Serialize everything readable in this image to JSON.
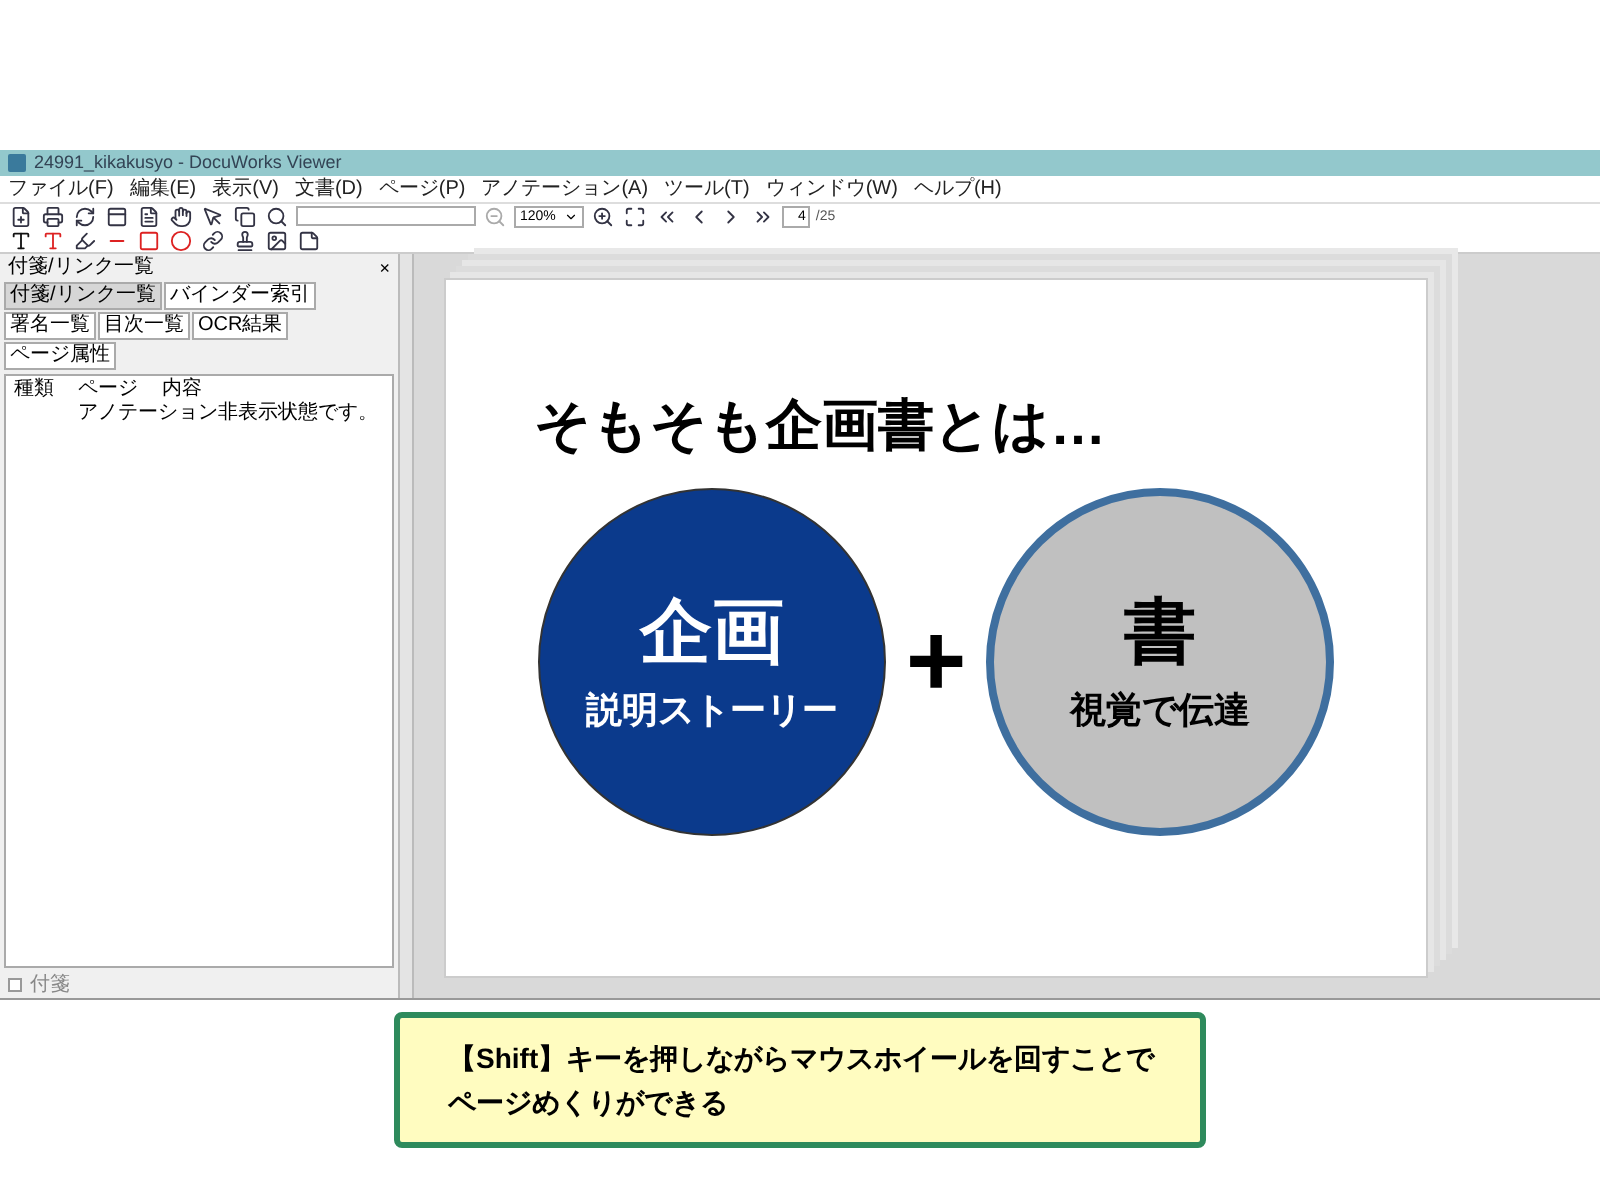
{
  "window": {
    "title": "24991_kikakusyo - DocuWorks Viewer"
  },
  "menu": [
    "ファイル(F)",
    "編集(E)",
    "表示(V)",
    "文書(D)",
    "ページ(P)",
    "アノテーション(A)",
    "ツール(T)",
    "ウィンドウ(W)",
    "ヘルプ(H)"
  ],
  "toolbar": {
    "zoom": "120%",
    "page": "4",
    "page_total": "/25"
  },
  "panel": {
    "title": "付箋/リンク一覧",
    "close": "×",
    "tabs": [
      {
        "label": "付箋/リンク一覧",
        "selected": true
      },
      {
        "label": "バインダー索引",
        "selected": false
      },
      {
        "label": "署名一覧",
        "selected": false
      },
      {
        "label": "目次一覧",
        "selected": false
      },
      {
        "label": "OCR結果",
        "selected": false
      },
      {
        "label": "ページ属性",
        "selected": false
      }
    ],
    "columns": [
      "種類",
      "ページ",
      "内容"
    ],
    "message": "アノテーション非表示状態です。",
    "footer_checkbox": {
      "label": "付箋",
      "checked": false
    }
  },
  "slide": {
    "title": "そもそも企画書とは…",
    "plus": "+",
    "circles": [
      {
        "main": "企画",
        "sub": "説明ストーリー",
        "color": "#0b3a8c"
      },
      {
        "main": "書",
        "sub": "視覚で伝達",
        "color": "#c0c0c0"
      }
    ]
  },
  "callout": {
    "lines": [
      "【Shift】キーを押しながらマウスホイールを回すことで",
      "ページめくりができる"
    ]
  }
}
